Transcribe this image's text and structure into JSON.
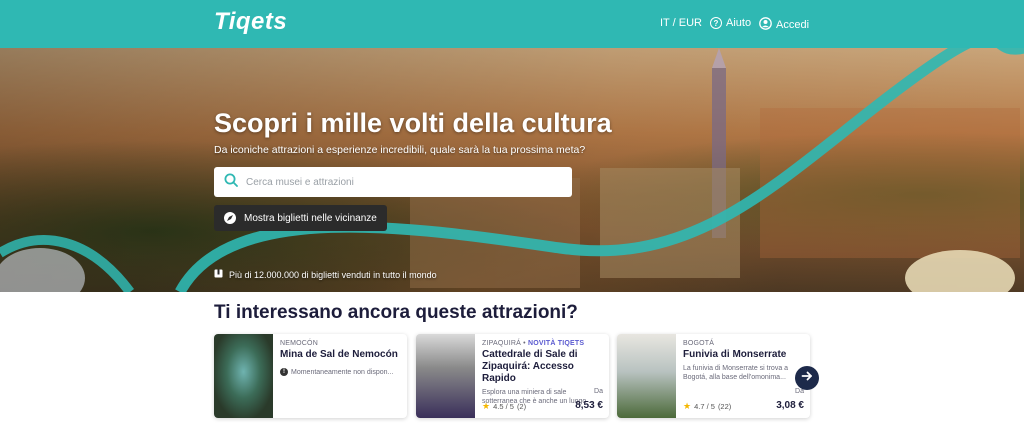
{
  "header": {
    "logo": "Tiqets",
    "locale": "IT / EUR",
    "help": "Aiuto",
    "login": "Accedi"
  },
  "hero": {
    "title": "Scopri i mille volti della cultura",
    "subtitle": "Da iconiche attrazioni a esperienze incredibili, quale sarà la tua prossima meta?",
    "search_placeholder": "Cerca musei e attrazioni",
    "nearby_label": "Mostra biglietti nelle vicinanze",
    "tickets_sold": "Più di 12.000.000 di biglietti venduti in tutto il mondo"
  },
  "section": {
    "title": "Ti interessano ancora queste attrazioni?"
  },
  "cards": [
    {
      "location": "NEMOCÓN",
      "name": "Mina de Sal de Nemocón",
      "status": "Momentaneamente non dispon..."
    },
    {
      "location": "ZIPAQUIRÁ",
      "tag": "NOVITÀ TIQETS",
      "name": "Cattedrale di Sale di Zipaquirá: Accesso Rapido",
      "description": "Esplora una miniera di sale sotterranea che è anche un luogo ...",
      "rating": "4.5 / 5",
      "reviews": "(2)",
      "from": "Da",
      "price": "8,53 €"
    },
    {
      "location": "BOGOTÁ",
      "name": "Funivia di Monserrate",
      "description": "La funivia di Monserrate si trova a Bogotá, alla base dell'omonima...",
      "rating": "4.7 / 5",
      "reviews": "(22)",
      "from": "Da",
      "price": "3,08 €"
    }
  ],
  "colors": {
    "brand": "#2fb8b3",
    "dark": "#1d1d3b",
    "star": "#f5b700"
  },
  "icons": [
    "help-circle-icon",
    "user-icon",
    "search-icon",
    "compass-icon",
    "ticket-icon",
    "info-icon",
    "star-icon",
    "arrow-right-icon"
  ]
}
